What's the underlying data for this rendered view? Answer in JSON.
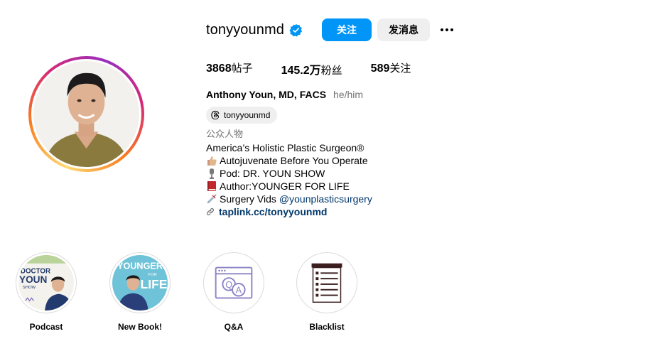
{
  "profile": {
    "username": "tonyyounmd",
    "follow_label": "关注",
    "message_label": "发消息",
    "full_name": "Anthony Youn, MD, FACS",
    "pronouns": "he/him",
    "threads_handle": "tonyyounmd"
  },
  "stats": {
    "posts_count": "3868",
    "posts_label": "帖子",
    "followers_count": "145.2万",
    "followers_label": "粉丝",
    "following_count": "589",
    "following_label": "关注"
  },
  "bio": {
    "category": "公众人物",
    "line1": "America’s Holistic Plastic Surgeon®",
    "line2": "Autojuvenate Before You Operate",
    "line3": "Pod: DR. YOUN SHOW",
    "line4": "Author:YOUNGER FOR LIFE",
    "line5_text": "Surgery Vids ",
    "line5_mention": "@younplasticsurgery",
    "link": "taplink.cc/tonyyounmd"
  },
  "highlights": [
    {
      "label": "Podcast",
      "art_text": [
        "DOCTOR",
        "YOUN",
        "SHOW"
      ]
    },
    {
      "label": "New Book!",
      "art_text": [
        "YOUNGER",
        "FOR",
        "LIFE"
      ]
    },
    {
      "label": "Q&A",
      "art_text": [
        "Q",
        "A"
      ]
    },
    {
      "label": "Blacklist"
    }
  ],
  "colors": {
    "accent": "#0095f6",
    "link": "#00376b",
    "secondary_text": "#737373",
    "button_gray": "#efefef"
  },
  "icons": [
    "verified-badge-icon",
    "more-options-icon",
    "threads-icon",
    "link-icon"
  ]
}
